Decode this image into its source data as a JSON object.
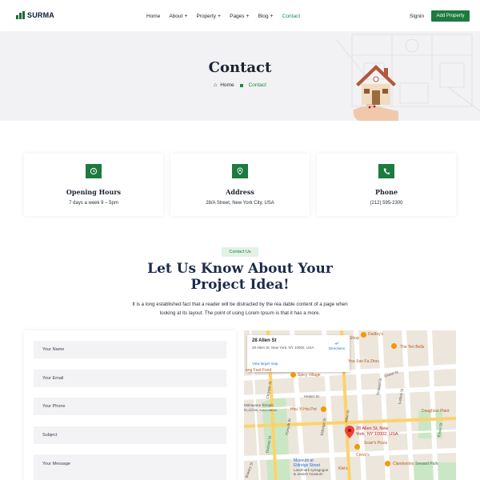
{
  "nav": {
    "logo": "SURMA",
    "items": [
      {
        "label": "Home",
        "has_submenu": false,
        "active": false
      },
      {
        "label": "About",
        "has_submenu": true,
        "active": false
      },
      {
        "label": "Property",
        "has_submenu": true,
        "active": false
      },
      {
        "label": "Pages",
        "has_submenu": true,
        "active": false
      },
      {
        "label": "Blog",
        "has_submenu": true,
        "active": false
      },
      {
        "label": "Contact",
        "has_submenu": false,
        "active": true
      }
    ],
    "signin": "Signin",
    "add_property": "Add Property"
  },
  "hero": {
    "title": "Contact",
    "breadcrumb": {
      "home": "Home",
      "current": "Contact"
    }
  },
  "cards": [
    {
      "icon": "clock-icon",
      "title": "Opening Hours",
      "text": "7 days a week 9 – 5pm"
    },
    {
      "icon": "map-pin-icon",
      "title": "Address",
      "text": "28/A Street, New York City, USA"
    },
    {
      "icon": "phone-icon",
      "title": "Phone",
      "text": "(212) 595-2300"
    }
  ],
  "contact": {
    "badge": "Contact Us",
    "title_line1": "Let Us Know About Your",
    "title_line2": "Project Idea!",
    "text": "It is a long established fact that a reader will be distracted by the rea dable content of a page when looking at its layout. The point of using Lorem Ipsum is that it has a more."
  },
  "form": {
    "name_placeholder": "Your Name",
    "email_placeholder": "Your Email",
    "phone_placeholder": "Your Phone",
    "subject_placeholder": "Subject",
    "message_placeholder": "Your Message"
  },
  "map": {
    "title": "28 Allen St",
    "address": "28 Allen St, New York, NY 10002, USA",
    "directions": "Directions",
    "larger_map": "View larger map",
    "pin_label_line1": "28 Allen St, New",
    "pin_label_line2": "York, NY 10002, USA",
    "places": {
      "dudleys": "Dudley's",
      "shop": "Shop",
      "ten_bells": "The Ten Bells",
      "you_jian": "You Jian Fa Zhou",
      "fast_food": "ung Fast Food",
      "spicy_village": "Spicy Village",
      "hou_yi": "Hou Yi Hot Pot",
      "mahayana_1": "Mahayana Temple",
      "mahayana_2": "Buddhist Association",
      "doughnut": "Doughnut Plant",
      "scarrs": "Scarr's Pizza",
      "museum_1": "Museum at",
      "museum_2": "Eldridge Street",
      "museum_3": "Landmark synagogue",
      "museum_4": "& Jewish museum",
      "cervos": "Cervo's",
      "clandestino": "Clandestino",
      "seward_park": "Seward Park",
      "kikis": "Kiki's"
    },
    "streets": {
      "grand": "Grand St",
      "hester": "Hester St",
      "allen": "Allen St",
      "orchard": "Orchard St",
      "ludlow": "Ludlow St",
      "essex": "Essex St",
      "chrystie": "Chrystie St",
      "forsyth": "Forsyth St",
      "eldridge": "Eldridge St",
      "bowery": "Bowery St",
      "division": "Division St"
    }
  },
  "colors": {
    "brand_green": "#1d7a3f",
    "active_link": "#1d8a45",
    "hero_bg": "#f2f2f4",
    "badge_bg": "#e3f1e7"
  }
}
